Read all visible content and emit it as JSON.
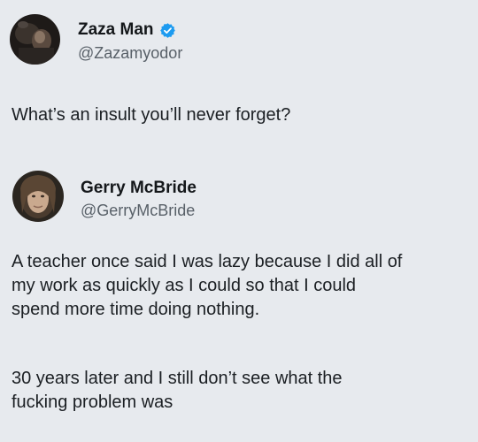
{
  "background_color": "#e7eaee",
  "accent_color": "#1d9bf0",
  "tweets": [
    {
      "name": "Zaza Man",
      "verified": true,
      "handle": "@Zazamyodor",
      "avatar_icon": "profile-photo-dark",
      "text_lines": [
        "What’s an insult you’ll never forget?"
      ]
    },
    {
      "name": "Gerry McBride",
      "verified": false,
      "handle": "@GerryMcBride",
      "avatar_icon": "profile-photo-portrait",
      "paragraph1": [
        "A teacher once said I was lazy because I did all of",
        "my work as quickly as I could so that I could",
        "spend more time doing nothing."
      ],
      "paragraph2": [
        "30 years later and I still don’t see what the",
        "fucking problem was"
      ]
    }
  ]
}
